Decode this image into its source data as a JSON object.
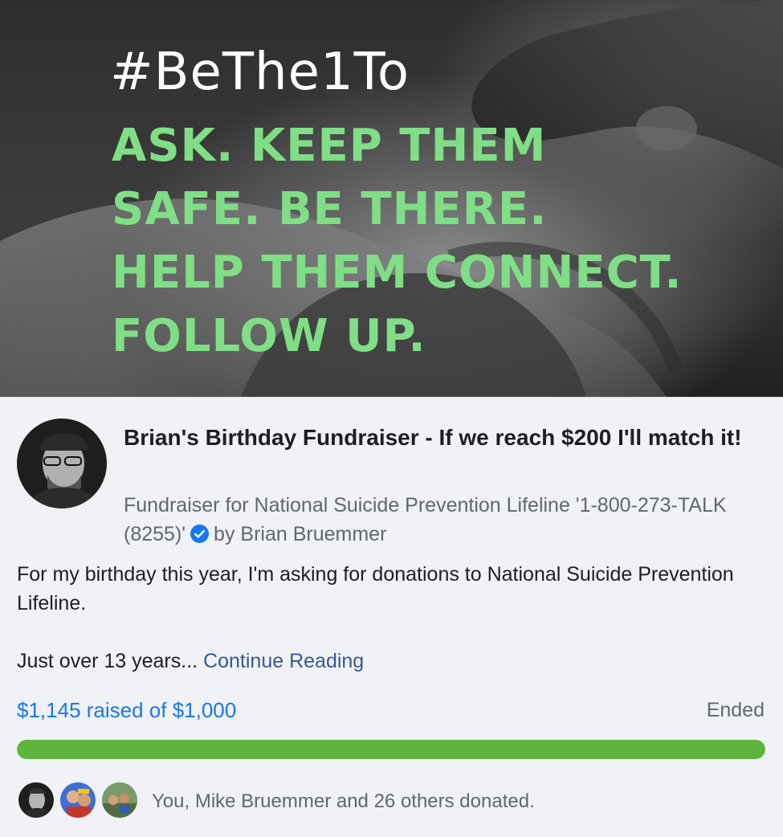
{
  "banner": {
    "hashtag": "#BeThe1To",
    "slogan_lines": [
      "ASK. KEEP THEM",
      "SAFE. BE THERE.",
      "HELP THEM CONNECT.",
      "FOLLOW UP."
    ],
    "slogan_color": "#80de86"
  },
  "fundraiser": {
    "title": "Brian's Birthday Fundraiser - If we reach $200 I'll match it!",
    "subtitle_prefix": "Fundraiser for National Suicide Prevention Lifeline '1-800-273-TALK (8255)'",
    "verified_icon": "verified-badge-icon",
    "by_text": "by Brian Bruemmer",
    "description": "For my birthday this year, I'm asking for donations to National Suicide Prevention Lifeline.",
    "excerpt": "Just over 13 years...",
    "continue_label": "Continue Reading",
    "raised_text": "$1,145 raised of $1,000",
    "status": "Ended",
    "progress_fraction": 1.0,
    "progress_color": "#5db53d",
    "accent_color": "#1877f2",
    "donors_text": "You, Mike Bruemmer and 26 others donated."
  }
}
